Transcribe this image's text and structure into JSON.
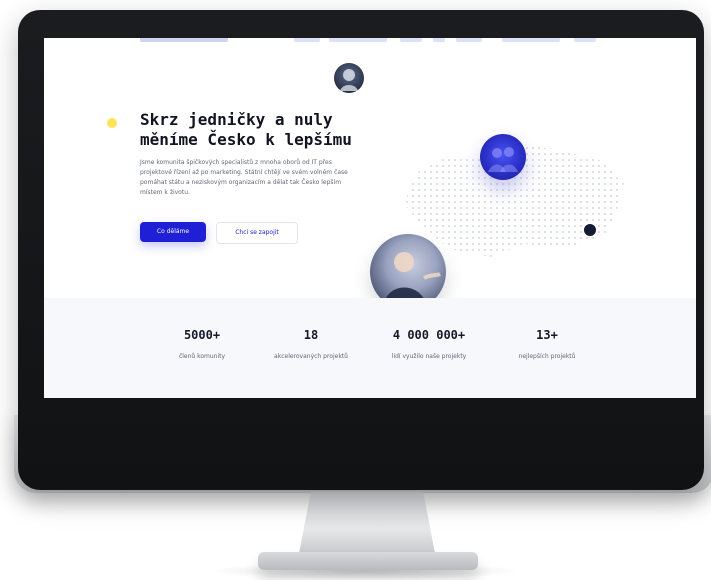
{
  "hero": {
    "title": "Skrz jedničky a nuly\nměníme Česko k lepšímu",
    "lead": "Jsme komunita špičkových specialistů z mnoha oborů od IT přes projektové řízení až po marketing. Státní chtějí ve svém volném čase pomáhat státu a neziskovým organizacím a dělat tak Česko lepším místem k životu.",
    "primary_button": "Co děláme",
    "secondary_button": "Chci se zapojit"
  },
  "stats": [
    {
      "value": "5000+",
      "label": "členů komunity"
    },
    {
      "value": "18",
      "label": "akcelerovaných projektů"
    },
    {
      "value": "4 000 000+",
      "label": "lidí využilo naše projekty"
    },
    {
      "value": "13+",
      "label": "nejlepších projektů"
    }
  ],
  "colors": {
    "accent": "#1f20d6",
    "title": "#121421",
    "yellow_dot": "#ffe45a",
    "navy_dot": "#141b35",
    "stats_background": "#f7f8fb"
  },
  "icons": {
    "top_avatar": "avatar",
    "right_avatar": "avatar",
    "bottom_avatar": "avatar"
  }
}
